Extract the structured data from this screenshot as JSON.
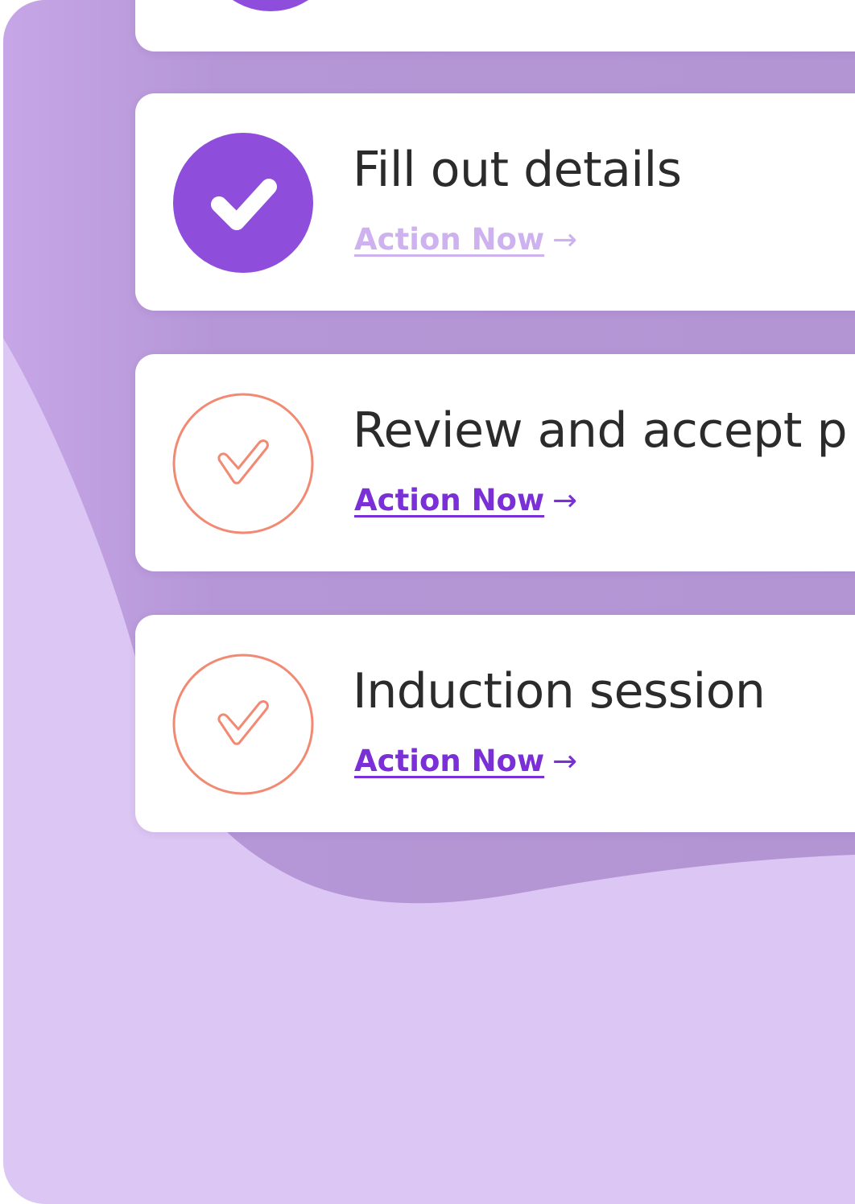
{
  "tasks": [
    {
      "title": "Fill out details",
      "action": "Action Now",
      "arrow": "→",
      "status": "completed",
      "status_icon": "check-filled-icon"
    },
    {
      "title": "Review and accept p",
      "action": "Action Now",
      "arrow": "→",
      "status": "pending",
      "status_icon": "check-outline-icon"
    },
    {
      "title": "Induction session",
      "action": "Action Now",
      "arrow": "→",
      "status": "pending",
      "status_icon": "check-outline-icon"
    }
  ],
  "colors": {
    "accent": "#7b2fd6",
    "completed_circle": "#8f4ddb",
    "pending_outline": "#f28a73",
    "background_light": "#dcc6f3",
    "background_blob": "#b898d8"
  }
}
